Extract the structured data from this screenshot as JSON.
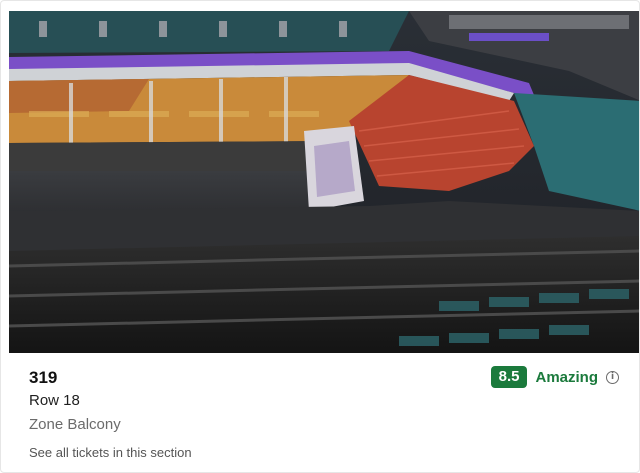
{
  "seat": {
    "section": "319",
    "row": "Row 18",
    "zone": "Zone Balcony",
    "see_all_link": "See all tickets in this section"
  },
  "rating": {
    "score": "8.5",
    "label": "Amazing",
    "info_icon": "info-icon"
  },
  "colors": {
    "rating_green": "#1b7a3c",
    "seat_red": "#b8442f",
    "seat_orange": "#c98a3a",
    "accent_purple": "#7a4fc7",
    "seat_teal": "#2b6d73"
  },
  "image": {
    "icon": "arena-view-image"
  }
}
